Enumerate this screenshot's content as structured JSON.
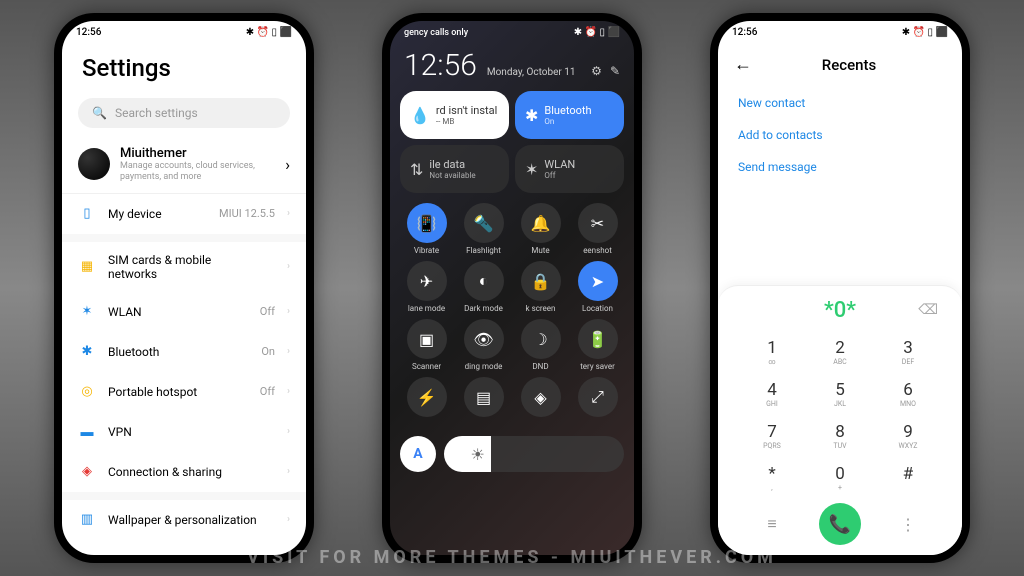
{
  "watermark": "Visit for more themes - miuithever.com",
  "status": {
    "time": "12:56",
    "icons": "✱ ⏰ ▯ ⬛"
  },
  "phone1": {
    "title": "Settings",
    "search_placeholder": "Search settings",
    "account": {
      "name": "Miuithemer",
      "sub": "Manage accounts, cloud services, payments, and more"
    },
    "mydevice": {
      "label": "My device",
      "value": "MIUI 12.5.5"
    },
    "items": [
      {
        "icon": "▦",
        "color": "#f5b400",
        "label": "SIM cards & mobile networks",
        "value": ""
      },
      {
        "icon": "✶",
        "color": "#1e88e5",
        "label": "WLAN",
        "value": "Off"
      },
      {
        "icon": "✱",
        "color": "#1e88e5",
        "label": "Bluetooth",
        "value": "On"
      },
      {
        "icon": "◎",
        "color": "#f5b400",
        "label": "Portable hotspot",
        "value": "Off"
      },
      {
        "icon": "▬",
        "color": "#1e88e5",
        "label": "VPN",
        "value": ""
      },
      {
        "icon": "◈",
        "color": "#e53935",
        "label": "Connection & sharing",
        "value": ""
      }
    ],
    "wallpaper": {
      "label": "Wallpaper & personalization"
    }
  },
  "phone2": {
    "carrier": "gency calls only",
    "time": "12:56",
    "date": "Monday, October 11",
    "tiles": [
      {
        "cls": "white",
        "icon": "💧",
        "title": "rd isn't instal",
        "sub": "-- MB"
      },
      {
        "cls": "blue",
        "icon": "✱",
        "title": "Bluetooth",
        "sub": "On"
      },
      {
        "cls": "dark",
        "icon": "⇅",
        "title": "ile data",
        "sub": "Not available"
      },
      {
        "cls": "dark",
        "icon": "✶",
        "title": "WLAN",
        "sub": "Off"
      }
    ],
    "toggles": [
      {
        "icon": "📳",
        "label": "Vibrate",
        "active": true
      },
      {
        "icon": "🔦",
        "label": "Flashlight",
        "active": false
      },
      {
        "icon": "🔔",
        "label": "Mute",
        "active": false
      },
      {
        "icon": "✂",
        "label": "eenshot",
        "active": false
      },
      {
        "icon": "✈",
        "label": "lane mode",
        "active": false
      },
      {
        "icon": "◐",
        "label": "Dark mode",
        "active": false
      },
      {
        "icon": "🔒",
        "label": "k screen",
        "active": false
      },
      {
        "icon": "➤",
        "label": "Location",
        "active": true
      },
      {
        "icon": "▣",
        "label": "Scanner",
        "active": false
      },
      {
        "icon": "👁",
        "label": "ding mode",
        "active": false
      },
      {
        "icon": "☽",
        "label": "DND",
        "active": false
      },
      {
        "icon": "🔋",
        "label": "tery saver",
        "active": false
      },
      {
        "icon": "⚡",
        "label": "",
        "active": false
      },
      {
        "icon": "▤",
        "label": "",
        "active": false
      },
      {
        "icon": "◈",
        "label": "",
        "active": false
      },
      {
        "icon": "⤢",
        "label": "",
        "active": false
      }
    ],
    "auto": "A"
  },
  "phone3": {
    "title": "Recents",
    "actions": [
      "New contact",
      "Add to contacts",
      "Send message"
    ],
    "display": "*0*",
    "keys": [
      {
        "d": "1",
        "l": "∞"
      },
      {
        "d": "2",
        "l": "ABC"
      },
      {
        "d": "3",
        "l": "DEF"
      },
      {
        "d": "4",
        "l": "GHI"
      },
      {
        "d": "5",
        "l": "JKL"
      },
      {
        "d": "6",
        "l": "MNO"
      },
      {
        "d": "7",
        "l": "PQRS"
      },
      {
        "d": "8",
        "l": "TUV"
      },
      {
        "d": "9",
        "l": "WXYZ"
      },
      {
        "d": "*",
        "l": ","
      },
      {
        "d": "0",
        "l": "+"
      },
      {
        "d": "#",
        "l": ""
      }
    ]
  }
}
